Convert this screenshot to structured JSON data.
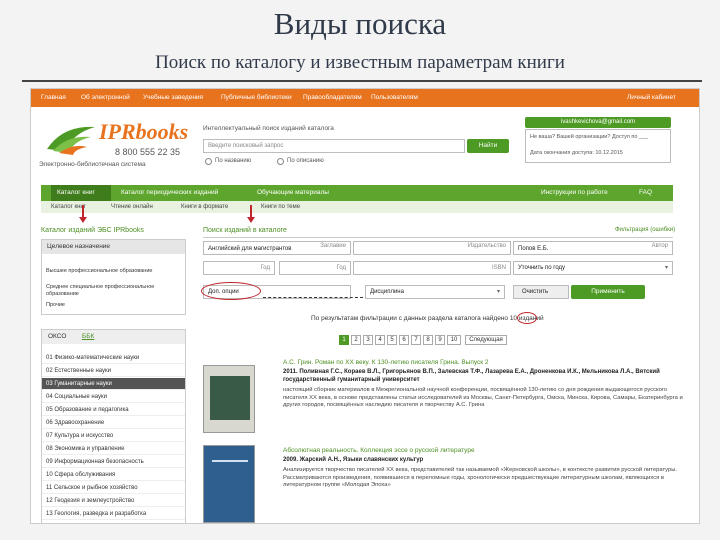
{
  "slide": {
    "title": "Виды поиска",
    "subtitle": "Поиск по каталогу и известным параметрам книги"
  },
  "topbar": {
    "items": [
      "Главная",
      "Об электронной",
      "Учебные заведения",
      "Публичные библиотеки",
      "Правообладателям",
      "Пользователям"
    ],
    "right": "Личный кабинет"
  },
  "logo": {
    "name": "IPRbooks",
    "phone": "8 800 555 22 35",
    "subtitle": "Электронно-библиотечная система"
  },
  "search": {
    "label": "Интеллектуальный поиск изданий каталога",
    "placeholder": "Введите поисковый запрос",
    "button": "Найти",
    "radio1": "По названию",
    "radio2": "По описанию"
  },
  "user": {
    "email": "ivashkevichova@gmail.com",
    "line1": "Не ваша? Вашей организации? Доступ по ___",
    "line2": "Дата окончания доступа: 10.12.2015"
  },
  "nav": {
    "items": [
      "Каталог книг",
      "Каталог периодических изданий",
      "Обучающие материалы"
    ],
    "right1": "Инструкции по работе",
    "right2": "FAQ"
  },
  "subnav": {
    "items": [
      "Каталог книг",
      "Чтение онлайн",
      "Книги в формате",
      "Книги по теме"
    ]
  },
  "sidebar": {
    "heading": "Каталог изданий ЭБС IPRbooks",
    "section1": "Целевое назначение",
    "items1": [
      "Высшее профессиональное образование",
      "Среднее специальное профессиональное образование",
      "Прочие"
    ],
    "tab1": "ОКСО",
    "tab2": "ББК",
    "categories": [
      "01 Физико-математические науки",
      "02 Естественные науки",
      "03 Гуманитарные науки",
      "04 Социальные науки",
      "05 Образование и педагогика",
      "06 Здравоохранение",
      "07 Культура и искусство",
      "08 Экономика и управление",
      "09 Информационная безопасность",
      "10 Сфера обслуживания",
      "11 Сельское и рыбное хозяйство",
      "12 Геодезия и землеустройство",
      "13 Геология, разведка и разработка"
    ],
    "active_index": 2
  },
  "filters": {
    "heading": "Поиск изданий в каталоге",
    "reset": "Фильтрация (ошибки)",
    "title_value": "Английский для магистрантов",
    "title_label": "Заглавие",
    "publisher_label": "Издательство",
    "author_value": "Попов Е.Б.",
    "author_label": "Автор",
    "year_label": "Год",
    "year_label2": "Год",
    "isbn_label": "ISBN",
    "sort_value": "Уточнить по году",
    "extra_label": "Доп. опции",
    "type_value": "Дисциплина",
    "clear_button": "Очистить",
    "apply_button": "Применить",
    "result_text": "По результатам фильтрации с данных раздела каталога найдено 10 изданий"
  },
  "pagination": {
    "pages": [
      "1",
      "2",
      "3",
      "4",
      "5",
      "6",
      "7",
      "8",
      "9",
      "10"
    ],
    "next": "Следующая",
    "active": "1"
  },
  "results": [
    {
      "title": "А.С. Грин. Роман по XX веку. К 130-летию писателя Грина. Выпуск 2",
      "meta": "2011. Поливная Г.С., Кораев В.Л., Григорьянов В.П., Залевская Т.Ф., Лазарева Е.А., Дроненкова И.К., Мельникова Л.А., Вятский государственный гуманитарный университет",
      "text": "настоящий сборник материалов в Межрегиональной научной конференции, посвящённой 130-летию со дня рождения выдающегося русского писателя XX века, в основе представлены статьи исследователей из Москвы, Санкт-Петербурга, Омска, Минска, Кирова, Самары, Екатеринбурга и других городов, посвящённых наследию писателя и творчеству А.С. Грина"
    },
    {
      "title": "Абсолютная реальность. Коллекция эссе о русской литературе",
      "meta": "2009. Жарский А.Н., Языки славянских культур",
      "text": "Анализируется творчество писателей XX века, представителей так называемой «Жерновской школы», в контексте развития русской литературы. Рассматриваются произведения, появившиеся в переломные годы, хронологически предшествующие литературным школам, являющихся в литературном группе «Молодая Эпоха»"
    }
  ]
}
